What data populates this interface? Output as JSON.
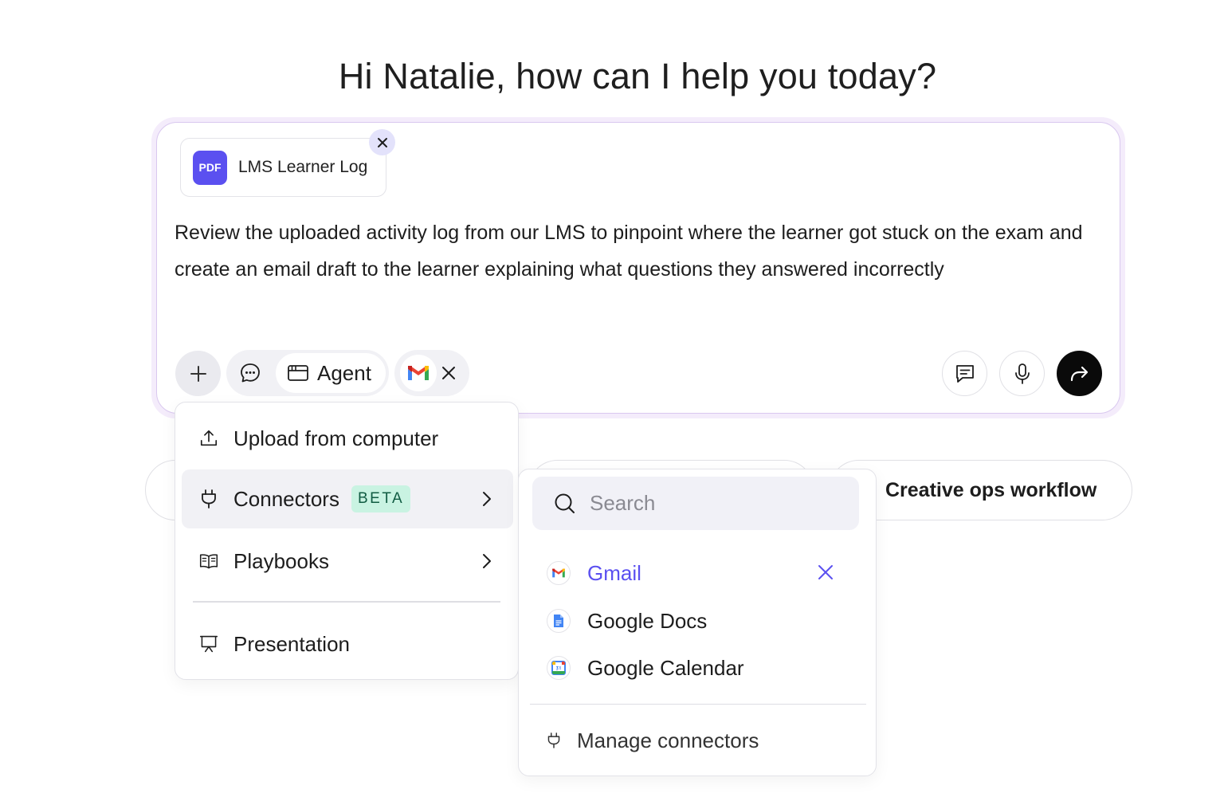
{
  "greeting": "Hi Natalie, how can I help you today?",
  "attachment": {
    "badge": "PDF",
    "name": "LMS Learner Log"
  },
  "prompt": "Review the uploaded activity log from our LMS to pinpoint where the learner got stuck on the exam and create an email draft to the learner explaining what questions they answered incorrectly",
  "toolbar": {
    "mode_label": "Agent"
  },
  "chips": {
    "right": "Creative ops workflow"
  },
  "menu": {
    "items": [
      {
        "label": "Upload from computer",
        "icon": "upload-icon"
      },
      {
        "label": "Connectors",
        "badge": "BETA",
        "icon": "plug-icon"
      },
      {
        "label": "Playbooks",
        "icon": "book-icon"
      },
      {
        "label": "Presentation",
        "icon": "presentation-icon"
      }
    ]
  },
  "connectors": {
    "search_placeholder": "Search",
    "items": [
      {
        "label": "Gmail",
        "selected": true
      },
      {
        "label": "Google Docs",
        "selected": false
      },
      {
        "label": "Google Calendar",
        "selected": false
      }
    ],
    "manage_label": "Manage connectors"
  },
  "colors": {
    "accent": "#5b50f0",
    "send": "#0a0a0a",
    "beta_bg": "#c9f3e2"
  }
}
